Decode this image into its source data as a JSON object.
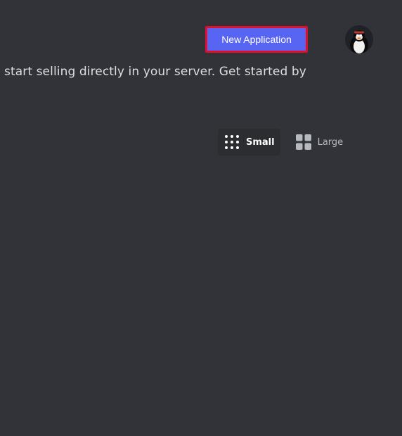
{
  "header": {
    "new_application_label": "New Application",
    "avatar_alt": "avatar"
  },
  "intro": {
    "text": "o start selling directly in your server. Get started by"
  },
  "view_toggle": {
    "options": [
      {
        "label": "Small",
        "icon": "grid-small-icon",
        "selected": true
      },
      {
        "label": "Large",
        "icon": "grid-large-icon",
        "selected": false
      }
    ]
  },
  "colors": {
    "background": "#313338",
    "accent": "#5865f2",
    "highlight_border": "#e0102a"
  }
}
